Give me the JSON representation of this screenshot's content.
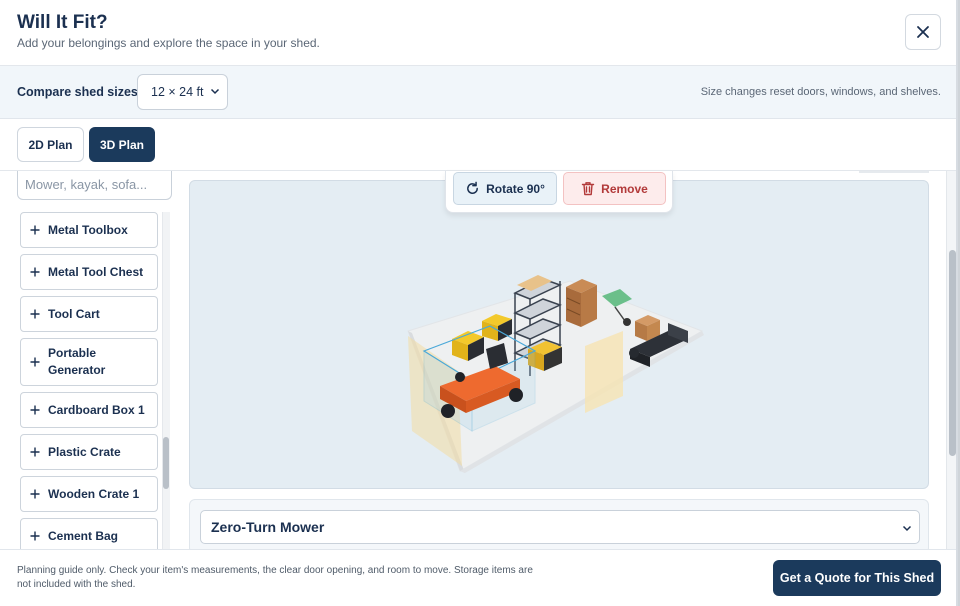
{
  "header": {
    "title": "Will It Fit?",
    "subtitle": "Add your belongings and explore the space in your shed.",
    "close_icon": "close-icon"
  },
  "compare": {
    "label": "Compare shed sizes",
    "selected_size": "12 × 24 ft",
    "note": "Size changes reset doors, windows, and shelves."
  },
  "view_tabs": [
    {
      "label": "2D Plan",
      "active": false
    },
    {
      "label": "3D Plan",
      "active": true
    }
  ],
  "sidebar": {
    "search_placeholder": "Mower, kayak, sofa...",
    "items": [
      {
        "label": "Metal Toolbox"
      },
      {
        "label": "Metal Tool Chest"
      },
      {
        "label": "Tool Cart"
      },
      {
        "label": "Portable Generator"
      },
      {
        "label": "Cardboard Box 1"
      },
      {
        "label": "Plastic Crate"
      },
      {
        "label": "Wooden Crate 1"
      },
      {
        "label": "Cement Bag"
      }
    ]
  },
  "stage_toolbar": {
    "rotate_label": "Rotate 90°",
    "remove_label": "Remove"
  },
  "selected_item": "Zero-Turn Mower",
  "footer": {
    "note": "Planning guide only. Check your item's measurements, the clear door opening, and room to move. Storage items are not included with the shed.",
    "quote_label": "Get a Quote for This Shed"
  },
  "colors": {
    "primary": "#1b3a5c",
    "remove_red": "#b23a3a",
    "stage_bg": "#e4edf3"
  }
}
